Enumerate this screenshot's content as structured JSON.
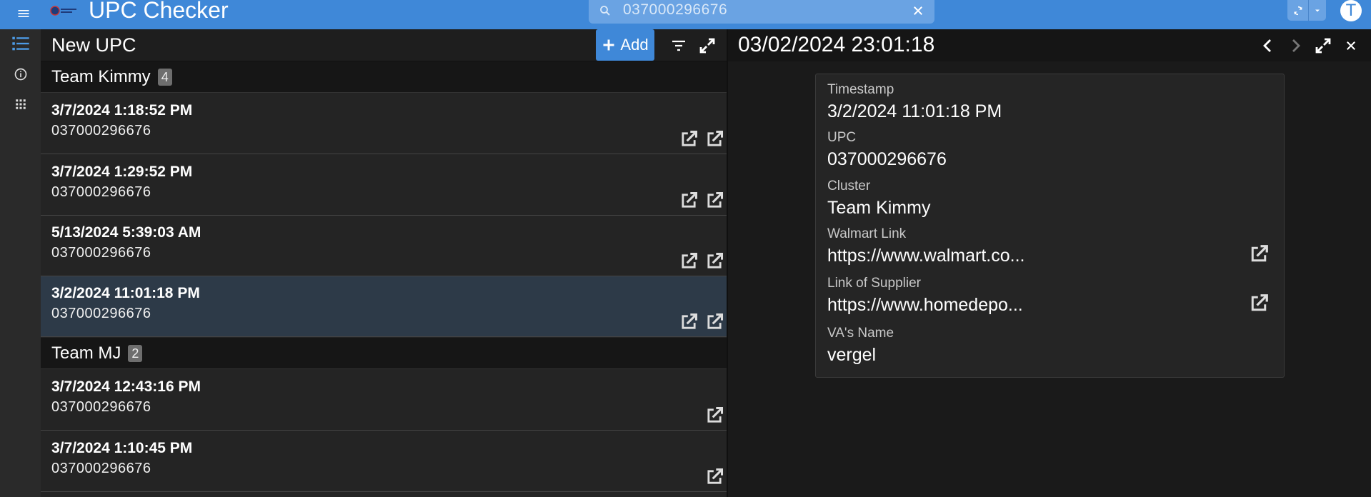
{
  "app": {
    "title": "UPC Checker",
    "logo_icon": "company-logo-icon"
  },
  "search": {
    "value": "037000296676"
  },
  "user": {
    "initial": "T"
  },
  "rail": {
    "items": [
      "list-view-icon",
      "info-icon",
      "apps-grid-icon"
    ]
  },
  "list": {
    "title": "New UPC",
    "add_label": "Add",
    "groups": [
      {
        "name": "Team Kimmy",
        "count": "4",
        "rows": [
          {
            "date": "3/7/2024 1:18:52 PM",
            "upc": "037000296676"
          },
          {
            "date": "3/7/2024 1:29:52 PM",
            "upc": "037000296676"
          },
          {
            "date": "5/13/2024 5:39:03 AM",
            "upc": "037000296676"
          },
          {
            "date": "3/2/2024 11:01:18 PM",
            "upc": "037000296676"
          }
        ]
      },
      {
        "name": "Team MJ",
        "count": "2",
        "rows": [
          {
            "date": "3/7/2024 12:43:16 PM",
            "upc": "037000296676"
          },
          {
            "date": "3/7/2024 1:10:45 PM",
            "upc": "037000296676"
          }
        ]
      }
    ]
  },
  "detail": {
    "title": "03/02/2024 23:01:18",
    "fields": {
      "timestamp_label": "Timestamp",
      "timestamp_value": "3/2/2024 11:01:18 PM",
      "upc_label": "UPC",
      "upc_value": "037000296676",
      "cluster_label": "Cluster",
      "cluster_value": "Team Kimmy",
      "walmart_label": "Walmart Link",
      "walmart_value": "https://www.walmart.co...",
      "supplier_label": "Link of Supplier",
      "supplier_value": "https://www.homedepo...",
      "va_label": "VA's Name",
      "va_value": "vergel"
    }
  },
  "colors": {
    "accent": "#3f88d8",
    "selected_row": "#2d3a48"
  }
}
